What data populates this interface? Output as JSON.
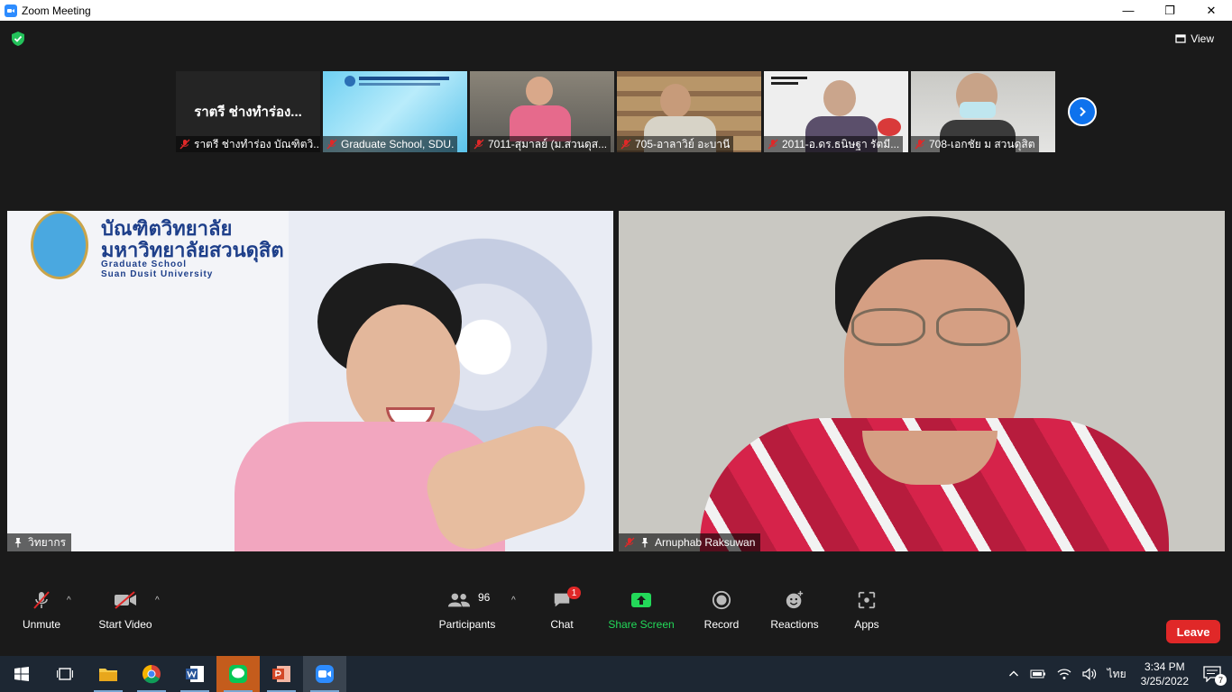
{
  "window": {
    "title": "Zoom Meeting",
    "icon": "zoom-camera-icon"
  },
  "window_controls": {
    "minimize": "—",
    "restore": "❐",
    "close": "✕"
  },
  "top_bar": {
    "view_label": "View",
    "security_icon": "shield-check-icon"
  },
  "thumbnails": [
    {
      "name": "ราตรี ช่างทำร่อง บัณฑิตวิ...",
      "display_name": "ราตรี ช่างทำร่อง...",
      "muted": true,
      "video": false
    },
    {
      "name": "Graduate School, SDU.",
      "muted": true,
      "video": true
    },
    {
      "name": "7011-สุมาลย์ (ม.สวนดุส...",
      "muted": true,
      "video": true
    },
    {
      "name": "705-อาลาวิย์ อะบานี",
      "muted": true,
      "video": true
    },
    {
      "name": "2011-อ.ดร.ธนิษฐา รัตมี...",
      "muted": true,
      "video": true
    },
    {
      "name": "708-เอกชัย ม สวนดุสิต",
      "muted": true,
      "video": true
    }
  ],
  "main_tiles": {
    "left": {
      "name": "วิทยากร",
      "pinned": true,
      "muted": false,
      "logo_title": "บัณฑิตวิทยาลัย",
      "logo_subtitle": "มหาวิทยาลัยสวนดุสิต",
      "logo_en1": "Graduate School",
      "logo_en2": "Suan Dusit University"
    },
    "right": {
      "name": "Arnuphab Raksuwan",
      "pinned": true,
      "muted": true
    }
  },
  "toolbar": {
    "unmute": "Unmute",
    "start_video": "Start Video",
    "participants": "Participants",
    "participants_count": "96",
    "chat": "Chat",
    "chat_badge": "1",
    "share_screen": "Share Screen",
    "record": "Record",
    "reactions": "Reactions",
    "apps": "Apps",
    "leave": "Leave",
    "caret": "^"
  },
  "taskbar": {
    "apps": [
      "windows-start-icon",
      "task-view-icon",
      "file-explorer-icon",
      "chrome-icon",
      "word-icon",
      "line-icon",
      "powerpoint-icon",
      "zoom-icon"
    ],
    "tray_lang": "ไทย",
    "time": "3:34 PM",
    "date": "3/25/2022",
    "notification_count": "7"
  },
  "colors": {
    "accent_blue": "#0e72ed",
    "leave_red": "#e02828",
    "share_green": "#23d959",
    "muted_red": "#e02828"
  }
}
